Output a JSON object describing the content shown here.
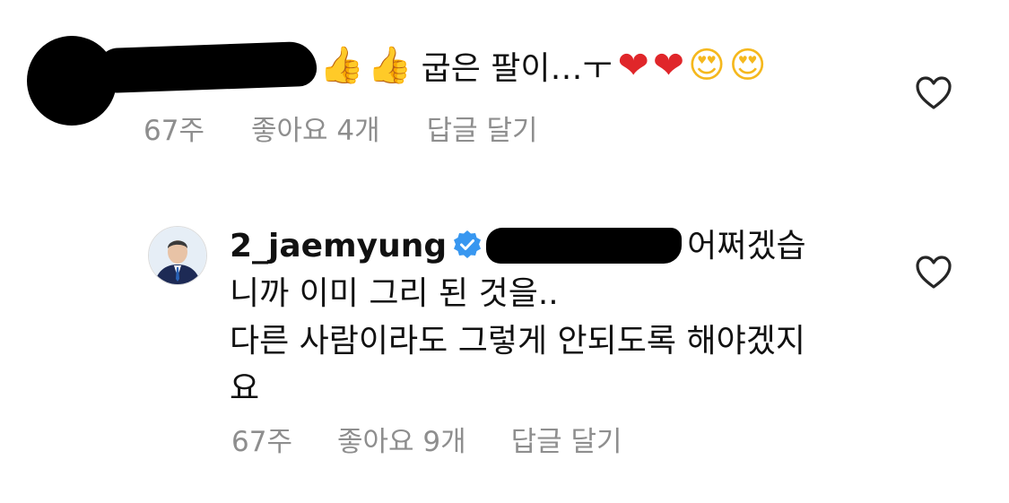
{
  "comment1": {
    "emoji_prefix": [
      "👍",
      "👍"
    ],
    "text": "굽은 팔이…ㅜ",
    "emoji_suffix": [
      "❤",
      "❤",
      "😍",
      "😍"
    ],
    "time": "67주",
    "likes": "좋아요 4개",
    "reply": "답글 달기"
  },
  "comment2": {
    "username": "2_jaemyung",
    "text_line1": "어쩌겠습",
    "text_line2": "니까 이미 그리 된 것을..",
    "text_line3": "다른 사람이라도 그렇게 안되도록 해야겠지",
    "text_line4": "요",
    "time": "67주",
    "likes": "좋아요 9개",
    "reply": "답글 달기"
  },
  "colors": {
    "meta_text": "#8e8e8e",
    "verified_badge": "#3897f0",
    "heart_outline": "#262626",
    "redaction": "#000000"
  },
  "icons": {
    "like": "heart-outline-icon",
    "verified": "verified-badge-icon"
  }
}
